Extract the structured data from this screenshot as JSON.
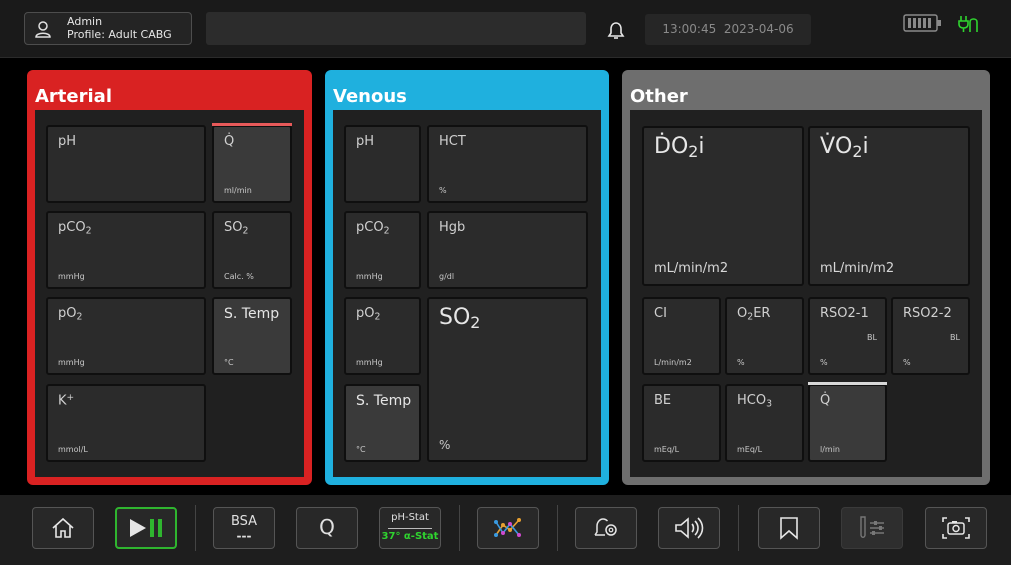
{
  "header": {
    "user_label": "Admin",
    "profile_label": "Profile: Adult CABG",
    "time": "13:00:45",
    "date": "2023-04-06"
  },
  "arterial": {
    "title": "Arterial",
    "ph": "pH",
    "q_label": "Q̇",
    "q_unit": "ml/min",
    "pco2_label": "pCO",
    "pco2_sub": "2",
    "pco2_unit": "mmHg",
    "so2_label": "SO",
    "so2_sub": "2",
    "so2_unit": "Calc. %",
    "po2_label": "pO",
    "po2_sub": "2",
    "po2_unit": "mmHg",
    "stemp_label": "S. Temp",
    "stemp_unit": "°C",
    "k_label": "K",
    "k_sup": "+",
    "k_unit": "mmol/L"
  },
  "venous": {
    "title": "Venous",
    "ph": "pH",
    "hct_label": "HCT",
    "hct_unit": "%",
    "pco2_label": "pCO",
    "pco2_sub": "2",
    "pco2_unit": "mmHg",
    "hgb_label": "Hgb",
    "hgb_unit": "g/dl",
    "po2_label": "pO",
    "po2_sub": "2",
    "po2_unit": "mmHg",
    "so2_label": "SO",
    "so2_sub": "2",
    "so2_unit": "%",
    "stemp_label": "S. Temp",
    "stemp_unit": "°C"
  },
  "other": {
    "title": "Other",
    "do2i_label": "ḊO",
    "do2i_sub": "2",
    "do2i_tail": "i",
    "do2i_unit": "mL/min/m2",
    "vo2i_label": "V̇O",
    "vo2i_sub": "2",
    "vo2i_tail": "i",
    "vo2i_unit": "mL/min/m2",
    "ci_label": "CI",
    "ci_unit": "L/min/m2",
    "o2er_pre": "O",
    "o2er_sub": "2",
    "o2er_tail": "ER",
    "o2er_unit": "%",
    "rso21_label": "RSO2-1",
    "rso21_bl": "BL",
    "rso21_unit": "%",
    "rso22_label": "RSO2-2",
    "rso22_bl": "BL",
    "rso22_unit": "%",
    "be_label": "BE",
    "be_unit": "mEq/L",
    "hco3_label": "HCO",
    "hco3_sub": "3",
    "hco3_unit": "mEq/L",
    "q_label": "Q̇",
    "q_unit": "l/min"
  },
  "toolbar": {
    "bsa_label": "BSA",
    "bsa_value": "---",
    "q_label": "Q",
    "phstat_label": "pH-Stat",
    "alphastat_label": "37° α-Stat"
  },
  "icons": {
    "user": "user-icon",
    "bell": "bell-icon",
    "battery": "battery-icon",
    "plug": "plug-icon",
    "home": "home-icon",
    "play_pause": "play-pause-icon",
    "trend": "trend-chart-icon",
    "alarm_settings": "alarm-settings-icon",
    "volume": "volume-icon",
    "bookmark": "bookmark-icon",
    "calibration": "calibration-icon",
    "camera": "camera-icon"
  },
  "colors": {
    "arterial": "#d92222",
    "venous": "#1fb0de",
    "other": "#6e6e6e",
    "play_green": "#2fb52f",
    "alpha_stat_green": "#2fd42f",
    "plug_green": "#2fd42f",
    "q_marker_red": "#e85a5a"
  }
}
